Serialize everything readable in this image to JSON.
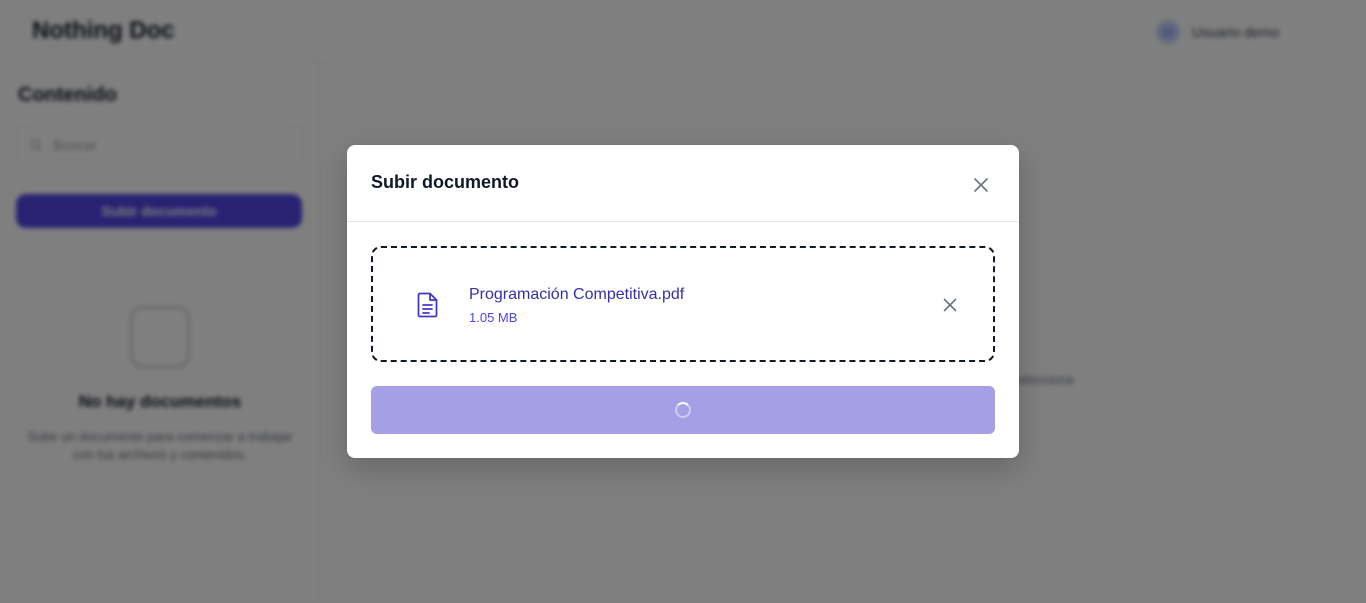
{
  "background": {
    "brand": "Nothing Doc",
    "user": {
      "initials": "U",
      "name": "Usuario demo"
    },
    "sidebar": {
      "title": "Contenido",
      "search_placeholder": "Buscar",
      "upload_label": "Subir documento",
      "empty_title": "No hay documentos",
      "empty_desc": "Sube un documento para comenzar a trabajar con tus archivos y contenidos."
    },
    "main_hint": "Selecciona"
  },
  "modal": {
    "title": "Subir documento",
    "close_icon": "close-icon",
    "file": {
      "name": "Programación Competitiva.pdf",
      "size": "1.05 MB",
      "icon": "document-icon"
    },
    "submit": {
      "state": "loading",
      "icon": "spinner-icon"
    }
  },
  "colors": {
    "accent": "#4f46e5",
    "accent_dark": "#3730a3",
    "button_disabled": "#a5a0e6",
    "overlay": "rgba(0,0,0,0.5)"
  }
}
